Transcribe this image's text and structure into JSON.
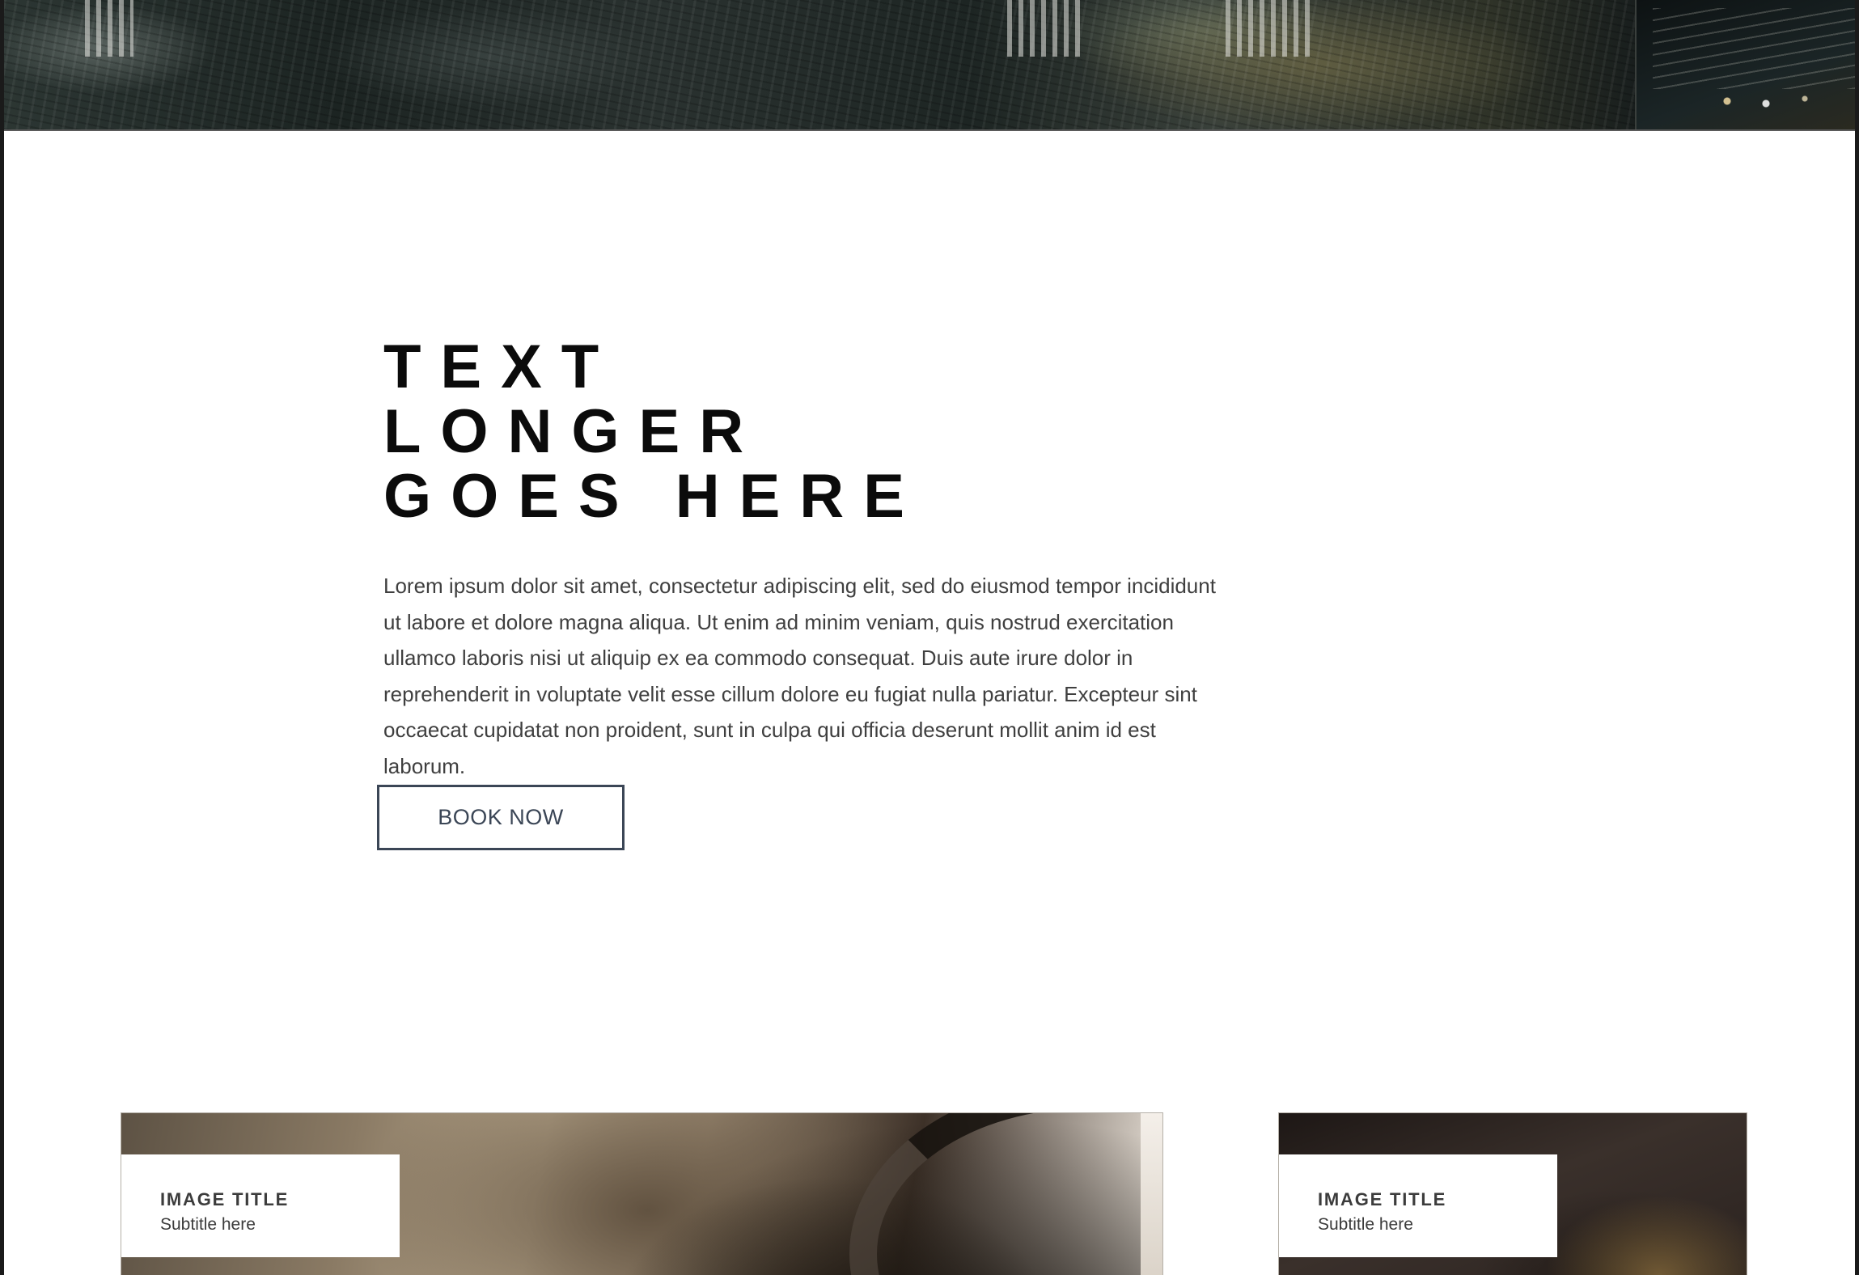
{
  "headline": {
    "lines": [
      "TEXT",
      "LONGER",
      "GOES HERE"
    ]
  },
  "intro": {
    "body": "Lorem ipsum dolor sit amet, consectetur adipiscing elit, sed do eiusmod tempor incididunt ut labore et dolore magna aliqua. Ut enim ad minim veniam, quis nostrud exercitation ullamco laboris nisi ut aliquip ex ea commodo consequat. Duis aute irure dolor in reprehenderit in voluptate velit esse cillum dolore eu fugiat nulla pariatur. Excepteur sint occaecat cupidatat non proident, sunt in culpa qui officia deserunt mollit anim id est laborum."
  },
  "cta": {
    "label": "BOOK NOW"
  },
  "cards": [
    {
      "title": "IMAGE TITLE",
      "subtitle": "Subtitle here"
    },
    {
      "title": "IMAGE TITLE",
      "subtitle": "Subtitle here"
    }
  ],
  "colors": {
    "headline": "#0b0b0b",
    "body_text": "#3f3f3f",
    "button_border": "#3b4656",
    "frame": "#1a1a1a"
  }
}
